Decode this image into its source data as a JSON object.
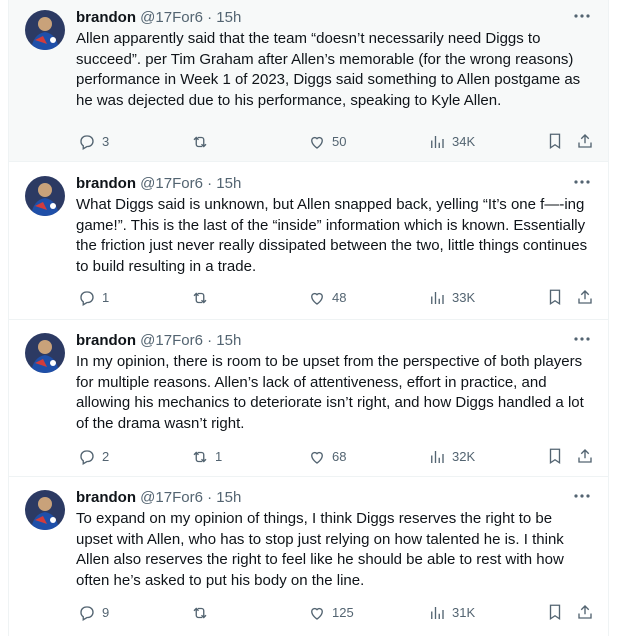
{
  "tweets": [
    {
      "name": "brandon",
      "handle": "@17For6 · 15h",
      "text": "Allen apparently said that the team “doesn’t necessarily need Diggs to succeed”. per Tim Graham after Allen’s memorable (for the wrong reasons) performance in Week 1 of 2023, Diggs said something to Allen postgame as he was dejected due to his performance, speaking to Kyle Allen.",
      "replies": "3",
      "retweets": "",
      "likes": "50",
      "views": "34K"
    },
    {
      "name": "brandon",
      "handle": "@17For6 · 15h",
      "text": "What Diggs said is unknown, but Allen snapped back, yelling “It’s one f—-ing game!”. This is the last of the “inside” information which is known. Essentially the friction just never really dissipated between the two, little things continues to build resulting in a trade.",
      "replies": "1",
      "retweets": "",
      "likes": "48",
      "views": "33K"
    },
    {
      "name": "brandon",
      "handle": "@17For6 · 15h",
      "text": "In my opinion, there is room to be upset from the perspective of both players for multiple reasons. Allen’s lack of attentiveness, effort in practice, and allowing his mechanics to deteriorate isn’t right, and how Diggs handled a lot of the drama wasn’t right.",
      "replies": "2",
      "retweets": "1",
      "likes": "68",
      "views": "32K"
    },
    {
      "name": "brandon",
      "handle": "@17For6 · 15h",
      "text": "To expand on my opinion of things, I think Diggs reserves the right to be upset with Allen, who has to stop just relying on how talented he is. I think Allen also reserves the right to feel like he should be able to rest with how often he’s asked to put his body on the line.",
      "replies": "9",
      "retweets": "",
      "likes": "125",
      "views": "31K"
    }
  ],
  "colors": {
    "text": "#0f1419",
    "muted": "#536471",
    "highlight_bg": "#f7f9f9",
    "border": "#eff3f4"
  }
}
